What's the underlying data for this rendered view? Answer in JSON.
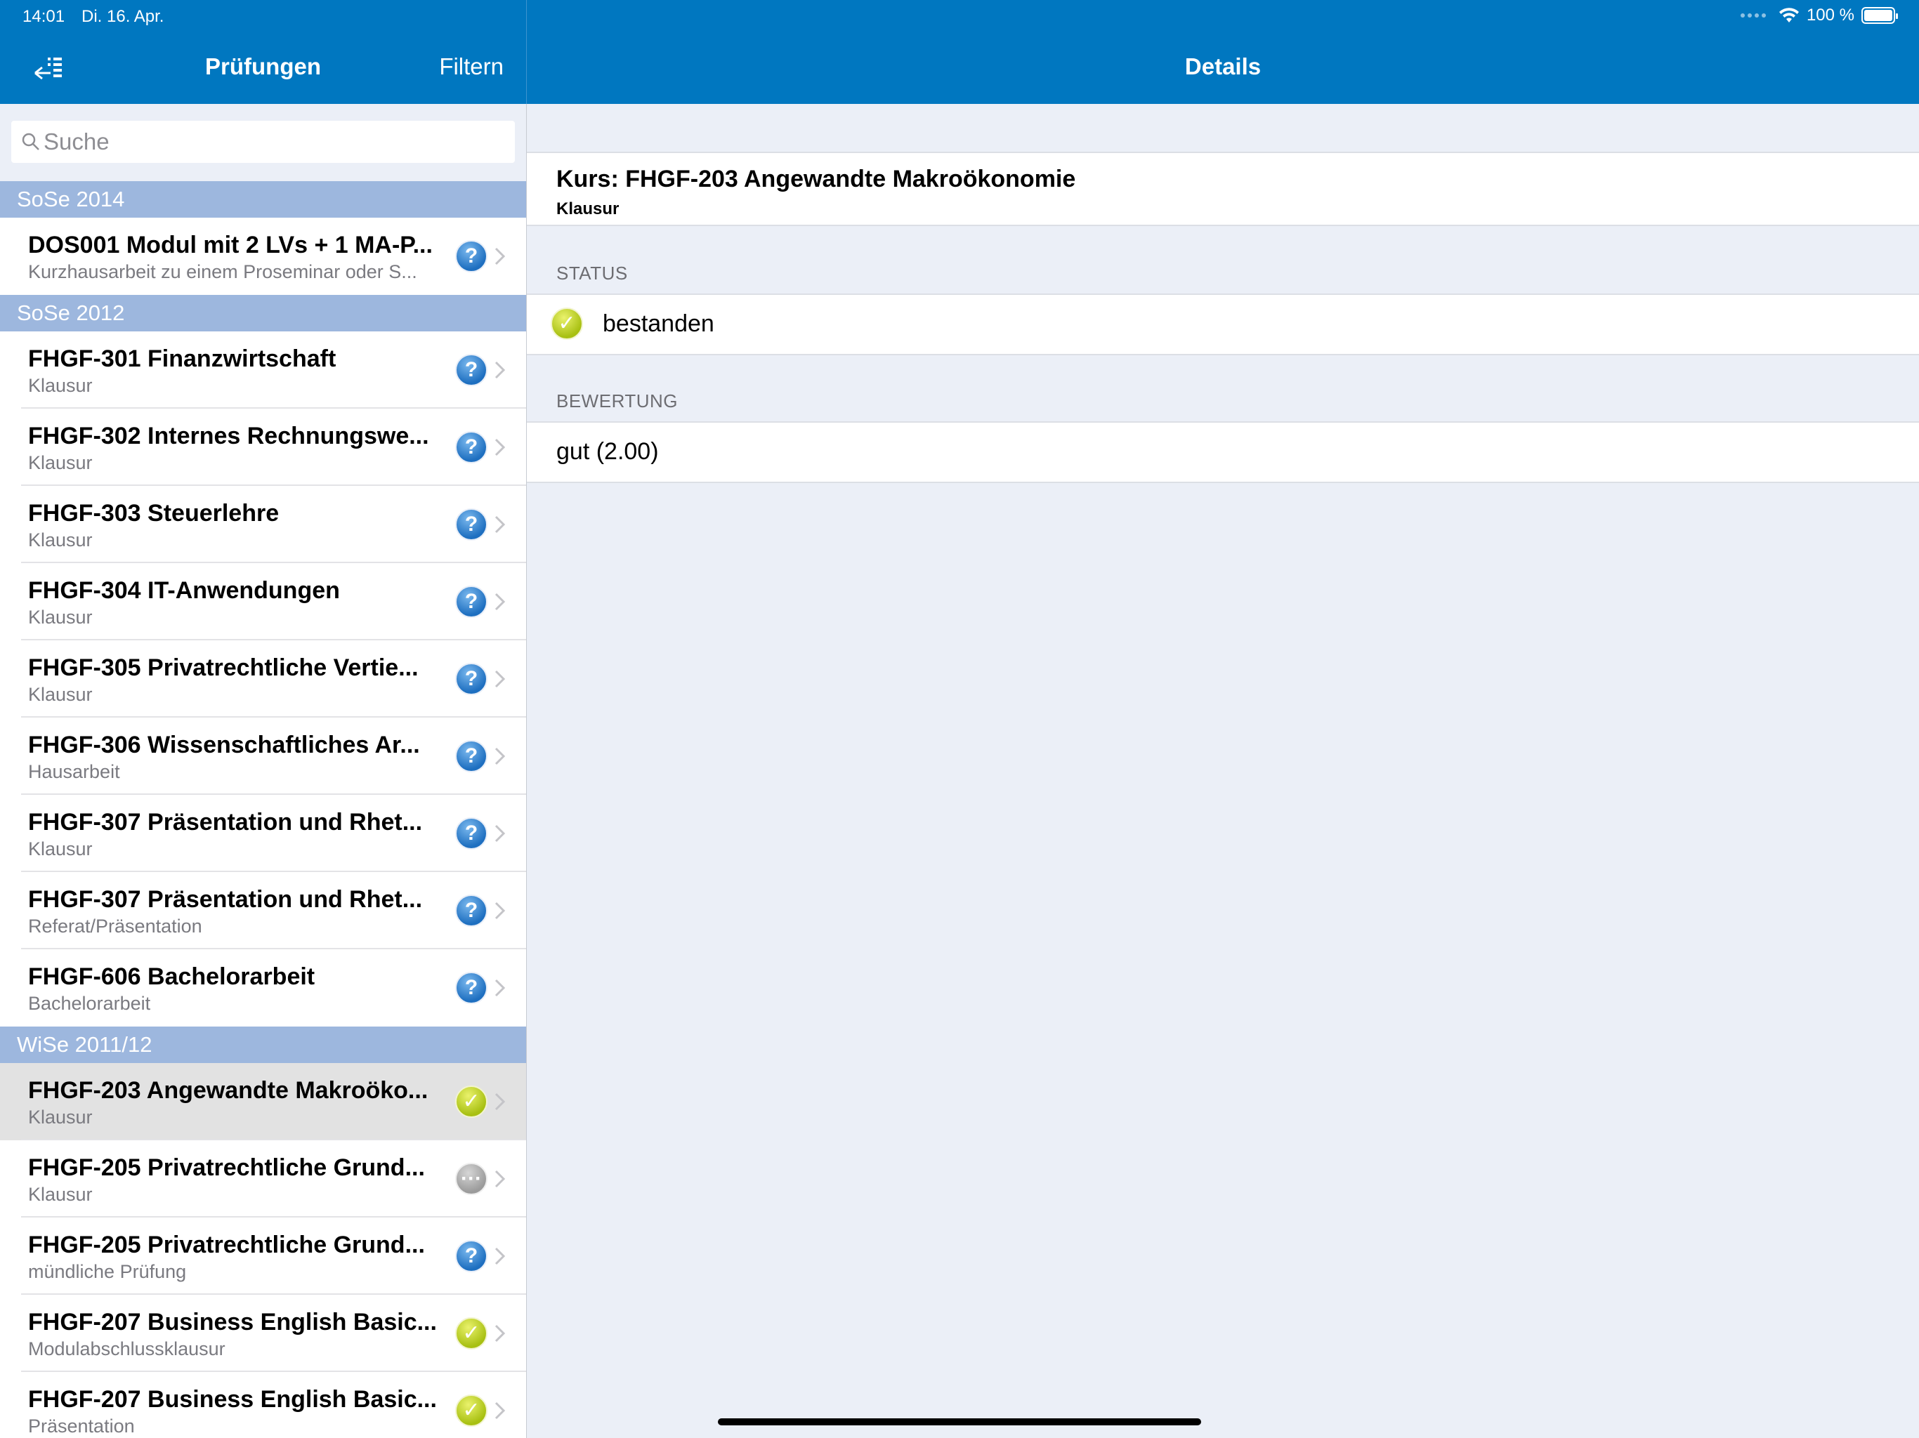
{
  "status_bar": {
    "time": "14:01",
    "date": "Di. 16. Apr.",
    "battery": "100 %",
    "battery_level_percent": 100,
    "icons": [
      "signal-dots-icon",
      "wifi-icon",
      "battery-icon"
    ]
  },
  "master": {
    "title": "Prüfungen",
    "filter_label": "Filtern",
    "back_icon": "collapse-sidebar-icon",
    "search": {
      "placeholder": "Suche",
      "value": ""
    },
    "sections": [
      {
        "header": "SoSe 2014",
        "rows": [
          {
            "title": "DOS001 Modul mit 2 LVs + 1 MA-P...",
            "subtitle": "Kurzhausarbeit zu einem Proseminar oder S...",
            "status": "question",
            "glyph": "?"
          }
        ]
      },
      {
        "header": "SoSe 2012",
        "rows": [
          {
            "title": "FHGF-301 Finanzwirtschaft",
            "subtitle": "Klausur",
            "status": "question",
            "glyph": "?"
          },
          {
            "title": "FHGF-302 Internes Rechnungswe...",
            "subtitle": "Klausur",
            "status": "question",
            "glyph": "?"
          },
          {
            "title": "FHGF-303 Steuerlehre",
            "subtitle": "Klausur",
            "status": "question",
            "glyph": "?"
          },
          {
            "title": "FHGF-304 IT-Anwendungen",
            "subtitle": "Klausur",
            "status": "question",
            "glyph": "?"
          },
          {
            "title": "FHGF-305 Privatrechtliche Vertie...",
            "subtitle": "Klausur",
            "status": "question",
            "glyph": "?"
          },
          {
            "title": "FHGF-306 Wissenschaftliches Ar...",
            "subtitle": "Hausarbeit",
            "status": "question",
            "glyph": "?"
          },
          {
            "title": "FHGF-307 Präsentation und Rhet...",
            "subtitle": "Klausur",
            "status": "question",
            "glyph": "?"
          },
          {
            "title": "FHGF-307 Präsentation und Rhet...",
            "subtitle": "Referat/Präsentation",
            "status": "question",
            "glyph": "?"
          },
          {
            "title": "FHGF-606 Bachelorarbeit",
            "subtitle": "Bachelorarbeit",
            "status": "question",
            "glyph": "?"
          }
        ]
      },
      {
        "header": "WiSe 2011/12",
        "rows": [
          {
            "title": "FHGF-203 Angewandte Makroöko...",
            "subtitle": "Klausur",
            "status": "passed",
            "glyph": "✓",
            "selected": true
          },
          {
            "title": "FHGF-205 Privatrechtliche Grund...",
            "subtitle": "Klausur",
            "status": "pending",
            "glyph": "···"
          },
          {
            "title": "FHGF-205 Privatrechtliche Grund...",
            "subtitle": "mündliche Prüfung",
            "status": "question",
            "glyph": "?"
          },
          {
            "title": "FHGF-207 Business English Basic...",
            "subtitle": "Modulabschlussklausur",
            "status": "passed",
            "glyph": "✓"
          },
          {
            "title": "FHGF-207 Business English Basic...",
            "subtitle": "Präsentation",
            "status": "passed",
            "glyph": "✓"
          }
        ]
      }
    ]
  },
  "detail": {
    "title": "Details",
    "course_title": "Kurs: FHGF-203 Angewandte Makroökonomie",
    "course_type": "Klausur",
    "status_label": "STATUS",
    "status_value": "bestanden",
    "status_glyph": "✓",
    "grade_label": "BEWERTUNG",
    "grade_value": "gut (2.00)"
  },
  "colors": {
    "nav_blue": "#0077c0",
    "section_header": "#9db7de",
    "background": "#ebeff7",
    "passed": "#b9cf1c",
    "question": "#2f7fcf",
    "pending": "#a8a8a8"
  }
}
